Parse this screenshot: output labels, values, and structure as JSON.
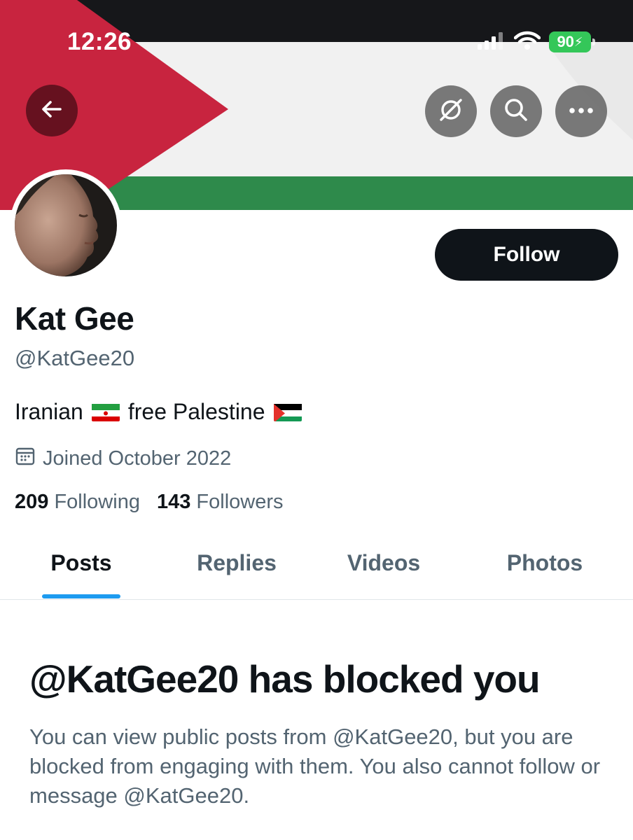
{
  "status_bar": {
    "time": "12:26",
    "battery": "90"
  },
  "header": {
    "back_icon": "arrow-left-icon",
    "grok_icon": "grok-icon",
    "search_icon": "search-icon",
    "more_icon": "more-horizontal-icon"
  },
  "profile": {
    "display_name": "Kat Gee",
    "handle": "@KatGee20",
    "follow_label": "Follow",
    "bio": {
      "part1": "Iranian",
      "part2": "free Palestine"
    },
    "joined": "Joined October 2022",
    "following_count": "209",
    "following_label": "Following",
    "followers_count": "143",
    "followers_label": "Followers"
  },
  "tabs": [
    {
      "label": "Posts"
    },
    {
      "label": "Replies"
    },
    {
      "label": "Videos"
    },
    {
      "label": "Photos"
    }
  ],
  "blocked": {
    "title": "@KatGee20 has blocked you",
    "body": "You can view public posts from @KatGee20, but you are blocked from engaging with them. You also cannot follow or message @KatGee20."
  },
  "colors": {
    "accent": "#1d9bf0",
    "text_primary": "#0f1419",
    "text_secondary": "#536471",
    "flag_red": "#c8243f",
    "flag_green": "#2d8a4a"
  }
}
